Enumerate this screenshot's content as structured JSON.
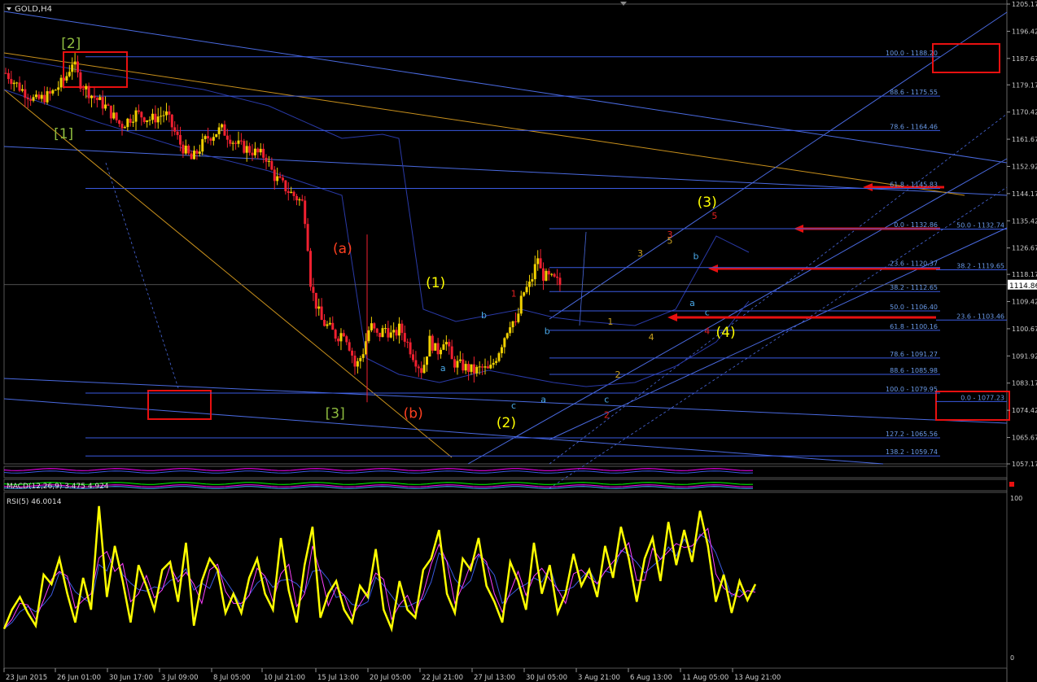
{
  "header": {
    "symbol_label": "GOLD,H4"
  },
  "chart_data": {
    "type": "candlestick",
    "symbol": "GOLD",
    "timeframe": "H4",
    "price_axis": {
      "ylim": [
        1057.17,
        1205.17
      ],
      "ticks": [
        1205.17,
        1196.42,
        1187.67,
        1179.17,
        1170.42,
        1161.67,
        1152.92,
        1144.17,
        1135.42,
        1126.67,
        1118.17,
        1109.42,
        1100.67,
        1091.92,
        1083.17,
        1074.42,
        1065.67,
        1057.17
      ]
    },
    "current_price_label": "1114.86",
    "time_axis": {
      "labels": [
        "23 Jun 2015",
        "26 Jun 01:00",
        "30 Jun 17:00",
        "3 Jul 09:00",
        "8 Jul 05:00",
        "10 Jul 21:00",
        "15 Jul 13:00",
        "20 Jul 05:00",
        "22 Jul 21:00",
        "27 Jul 13:00",
        "30 Jul 05:00",
        "3 Aug 21:00",
        "6 Aug 13:00",
        "11 Aug 05:00",
        "13 Aug 21:00"
      ]
    },
    "price_path": [
      [
        0,
        1183
      ],
      [
        4,
        1178
      ],
      [
        8,
        1174
      ],
      [
        12,
        1176
      ],
      [
        16,
        1181
      ],
      [
        18,
        1187
      ],
      [
        20,
        1180
      ],
      [
        23,
        1176
      ],
      [
        27,
        1172
      ],
      [
        31,
        1166
      ],
      [
        35,
        1170
      ],
      [
        39,
        1168
      ],
      [
        43,
        1170
      ],
      [
        47,
        1160
      ],
      [
        50,
        1155
      ],
      [
        54,
        1162
      ],
      [
        58,
        1165
      ],
      [
        62,
        1160
      ],
      [
        66,
        1158
      ],
      [
        70,
        1156
      ],
      [
        72,
        1150
      ],
      [
        76,
        1145
      ],
      [
        80,
        1141
      ],
      [
        81,
        1131
      ],
      [
        82,
        1115
      ],
      [
        83,
        1110
      ],
      [
        85,
        1103
      ],
      [
        87,
        1101
      ],
      [
        89,
        1098
      ],
      [
        91,
        1100
      ],
      [
        93,
        1093
      ],
      [
        94,
        1088
      ],
      [
        96,
        1093
      ],
      [
        98,
        1102
      ],
      [
        100,
        1098
      ],
      [
        102,
        1101
      ],
      [
        104,
        1098
      ],
      [
        106,
        1101
      ],
      [
        108,
        1096
      ],
      [
        110,
        1091
      ],
      [
        112,
        1087
      ],
      [
        114,
        1097
      ],
      [
        116,
        1093
      ],
      [
        118,
        1098
      ],
      [
        120,
        1090
      ],
      [
        122,
        1089
      ],
      [
        124,
        1088
      ],
      [
        126,
        1087
      ],
      [
        128,
        1088
      ],
      [
        130,
        1087
      ],
      [
        132,
        1092
      ],
      [
        134,
        1098
      ],
      [
        136,
        1104
      ],
      [
        137,
        1101
      ],
      [
        139,
        1112
      ],
      [
        141,
        1115
      ],
      [
        142,
        1119
      ],
      [
        143,
        1124
      ],
      [
        144,
        1118
      ],
      [
        146,
        1117
      ],
      [
        148,
        1116
      ],
      [
        149,
        1114.86
      ]
    ],
    "fib_levels_left": [
      {
        "label": "100.0 - 1188.20",
        "price": 1188.2
      },
      {
        "label": "88.6 - 1175.55",
        "price": 1175.55
      },
      {
        "label": "78.6 - 1164.46",
        "price": 1164.46
      },
      {
        "label": "61.8 - 1145.83",
        "price": 1145.83
      },
      {
        "label": "0.0 - 1132.86",
        "price": 1132.86
      },
      {
        "label": "23.6 - 1120.37",
        "price": 1120.37
      },
      {
        "label": "38.2 - 1112.65",
        "price": 1112.65
      },
      {
        "label": "50.0 - 1106.40",
        "price": 1106.4
      },
      {
        "label": "61.8 - 1100.16",
        "price": 1100.16
      },
      {
        "label": "78.6 - 1091.27",
        "price": 1091.27
      },
      {
        "label": "88.6 - 1085.98",
        "price": 1085.98
      },
      {
        "label": "100.0 - 1079.95",
        "price": 1079.95
      },
      {
        "label": "127.2 - 1065.56",
        "price": 1065.56
      },
      {
        "label": "138.2 - 1059.74",
        "price": 1059.74
      }
    ],
    "fib_levels_right": [
      {
        "label": "50.0 - 1132.74",
        "price": 1132.74
      },
      {
        "label": "38.2 - 1119.65",
        "price": 1119.65
      },
      {
        "label": "23.6 - 1103.46",
        "price": 1103.46
      },
      {
        "label": "0.0 - 1077.23",
        "price": 1077.23
      }
    ],
    "wave_labels": [
      {
        "text": "[2]",
        "color": "#8fbc3f",
        "price": 1191,
        "t": 18
      },
      {
        "text": "[1]",
        "color": "#8fbc3f",
        "price": 1162,
        "t": 16
      },
      {
        "text": "[3]",
        "color": "#8fbc3f",
        "price": 1072,
        "t": 89
      },
      {
        "text": "(a)",
        "color": "#ff4020",
        "price": 1125,
        "t": 91
      },
      {
        "text": "(b)",
        "color": "#ff4020",
        "price": 1072,
        "t": 110
      },
      {
        "text": "(1)",
        "color": "#ffff00",
        "price": 1114,
        "t": 116
      },
      {
        "text": "(2)",
        "color": "#ffff00",
        "price": 1069,
        "t": 135
      },
      {
        "text": "(3)",
        "color": "#ffff00",
        "price": 1140,
        "t": 189
      },
      {
        "text": "(4)",
        "color": "#ffff00",
        "price": 1098,
        "t": 194
      },
      {
        "text": "1",
        "color": "#e02020",
        "price": 1111,
        "t": 137
      },
      {
        "text": "2",
        "color": "#e02020",
        "price": 1072,
        "t": 162
      },
      {
        "text": "3",
        "color": "#e02020",
        "price": 1130,
        "t": 179
      },
      {
        "text": "4",
        "color": "#e02020",
        "price": 1099,
        "t": 189
      },
      {
        "text": "5",
        "color": "#e02020",
        "price": 1136,
        "t": 191
      },
      {
        "text": "1",
        "color": "#c8a020",
        "price": 1102,
        "t": 163
      },
      {
        "text": "2",
        "color": "#c8a020",
        "price": 1085,
        "t": 165
      },
      {
        "text": "3",
        "color": "#c8a020",
        "price": 1124,
        "t": 171
      },
      {
        "text": "4",
        "color": "#c8a020",
        "price": 1097,
        "t": 174
      },
      {
        "text": "5",
        "color": "#c8a020",
        "price": 1128,
        "t": 179
      },
      {
        "text": "a",
        "color": "#4aa8e8",
        "price": 1087,
        "t": 118
      },
      {
        "text": "b",
        "color": "#4aa8e8",
        "price": 1104,
        "t": 129
      },
      {
        "text": "c",
        "color": "#4aa8e8",
        "price": 1075,
        "t": 137
      },
      {
        "text": "a",
        "color": "#4aa8e8",
        "price": 1077,
        "t": 145
      },
      {
        "text": "b",
        "color": "#4aa8e8",
        "price": 1099,
        "t": 146
      },
      {
        "text": "c",
        "color": "#4aa8e8",
        "price": 1077,
        "t": 162
      },
      {
        "text": "b",
        "color": "#4aa8e8",
        "price": 1123,
        "t": 186
      },
      {
        "text": "a",
        "color": "#4aa8e8",
        "price": 1108,
        "t": 185
      },
      {
        "text": "c",
        "color": "#4aa8e8",
        "price": 1105,
        "t": 189
      }
    ],
    "subwindow1_label": "MACD(12,26,9) 3.475 4.924",
    "rsi": {
      "label": "RSI(5) 46.0014",
      "ylim": [
        0,
        100
      ],
      "ticks": [
        "100",
        "0"
      ],
      "values": [
        18,
        30,
        38,
        28,
        20,
        52,
        46,
        62,
        40,
        22,
        50,
        30,
        95,
        38,
        70,
        48,
        22,
        58,
        45,
        30,
        55,
        60,
        35,
        72,
        20,
        48,
        62,
        55,
        28,
        40,
        28,
        50,
        62,
        40,
        30,
        75,
        42,
        22,
        58,
        82,
        25,
        40,
        48,
        30,
        22,
        45,
        38,
        68,
        30,
        18,
        48,
        30,
        25,
        55,
        62,
        80,
        40,
        28,
        62,
        55,
        75,
        45,
        35,
        22,
        60,
        48,
        30,
        72,
        40,
        58,
        28,
        40,
        65,
        45,
        55,
        38,
        70,
        50,
        82,
        62,
        35,
        62,
        75,
        48,
        85,
        58,
        80,
        60,
        92,
        70,
        35,
        52,
        28,
        48,
        36,
        46
      ]
    }
  },
  "colors": {
    "background": "#000000",
    "bull_candle": "#f0d000",
    "bear_candle": "#f02030",
    "grid_line": "#3050d0",
    "trend_line": "#4a6ae0",
    "orange_line": "#c8901c",
    "rsi_line": "#ffff00",
    "annotation_red": "#e81010"
  }
}
